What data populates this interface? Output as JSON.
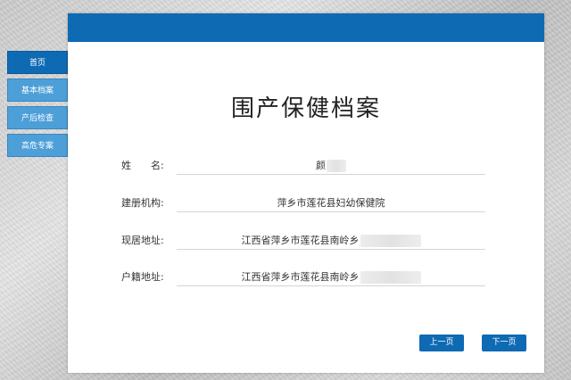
{
  "sidebar": {
    "items": [
      {
        "label": "首页"
      },
      {
        "label": "基本档案"
      },
      {
        "label": "产后检查"
      },
      {
        "label": "高危专案"
      }
    ]
  },
  "panel": {
    "title": "围产保健档案",
    "fields": [
      {
        "label": "姓　　名:",
        "value": "颜"
      },
      {
        "label": "建册机构:",
        "value": "萍乡市莲花县妇幼保健院"
      },
      {
        "label": "现居地址:",
        "value": "江西省萍乡市莲花县南岭乡"
      },
      {
        "label": "户籍地址:",
        "value": "江西省萍乡市莲花县南岭乡"
      }
    ]
  },
  "buttons": {
    "prev": "上一页",
    "next": "下一页"
  },
  "colors": {
    "primary": "#0f6ab4",
    "nav": "#4d9fd8"
  }
}
